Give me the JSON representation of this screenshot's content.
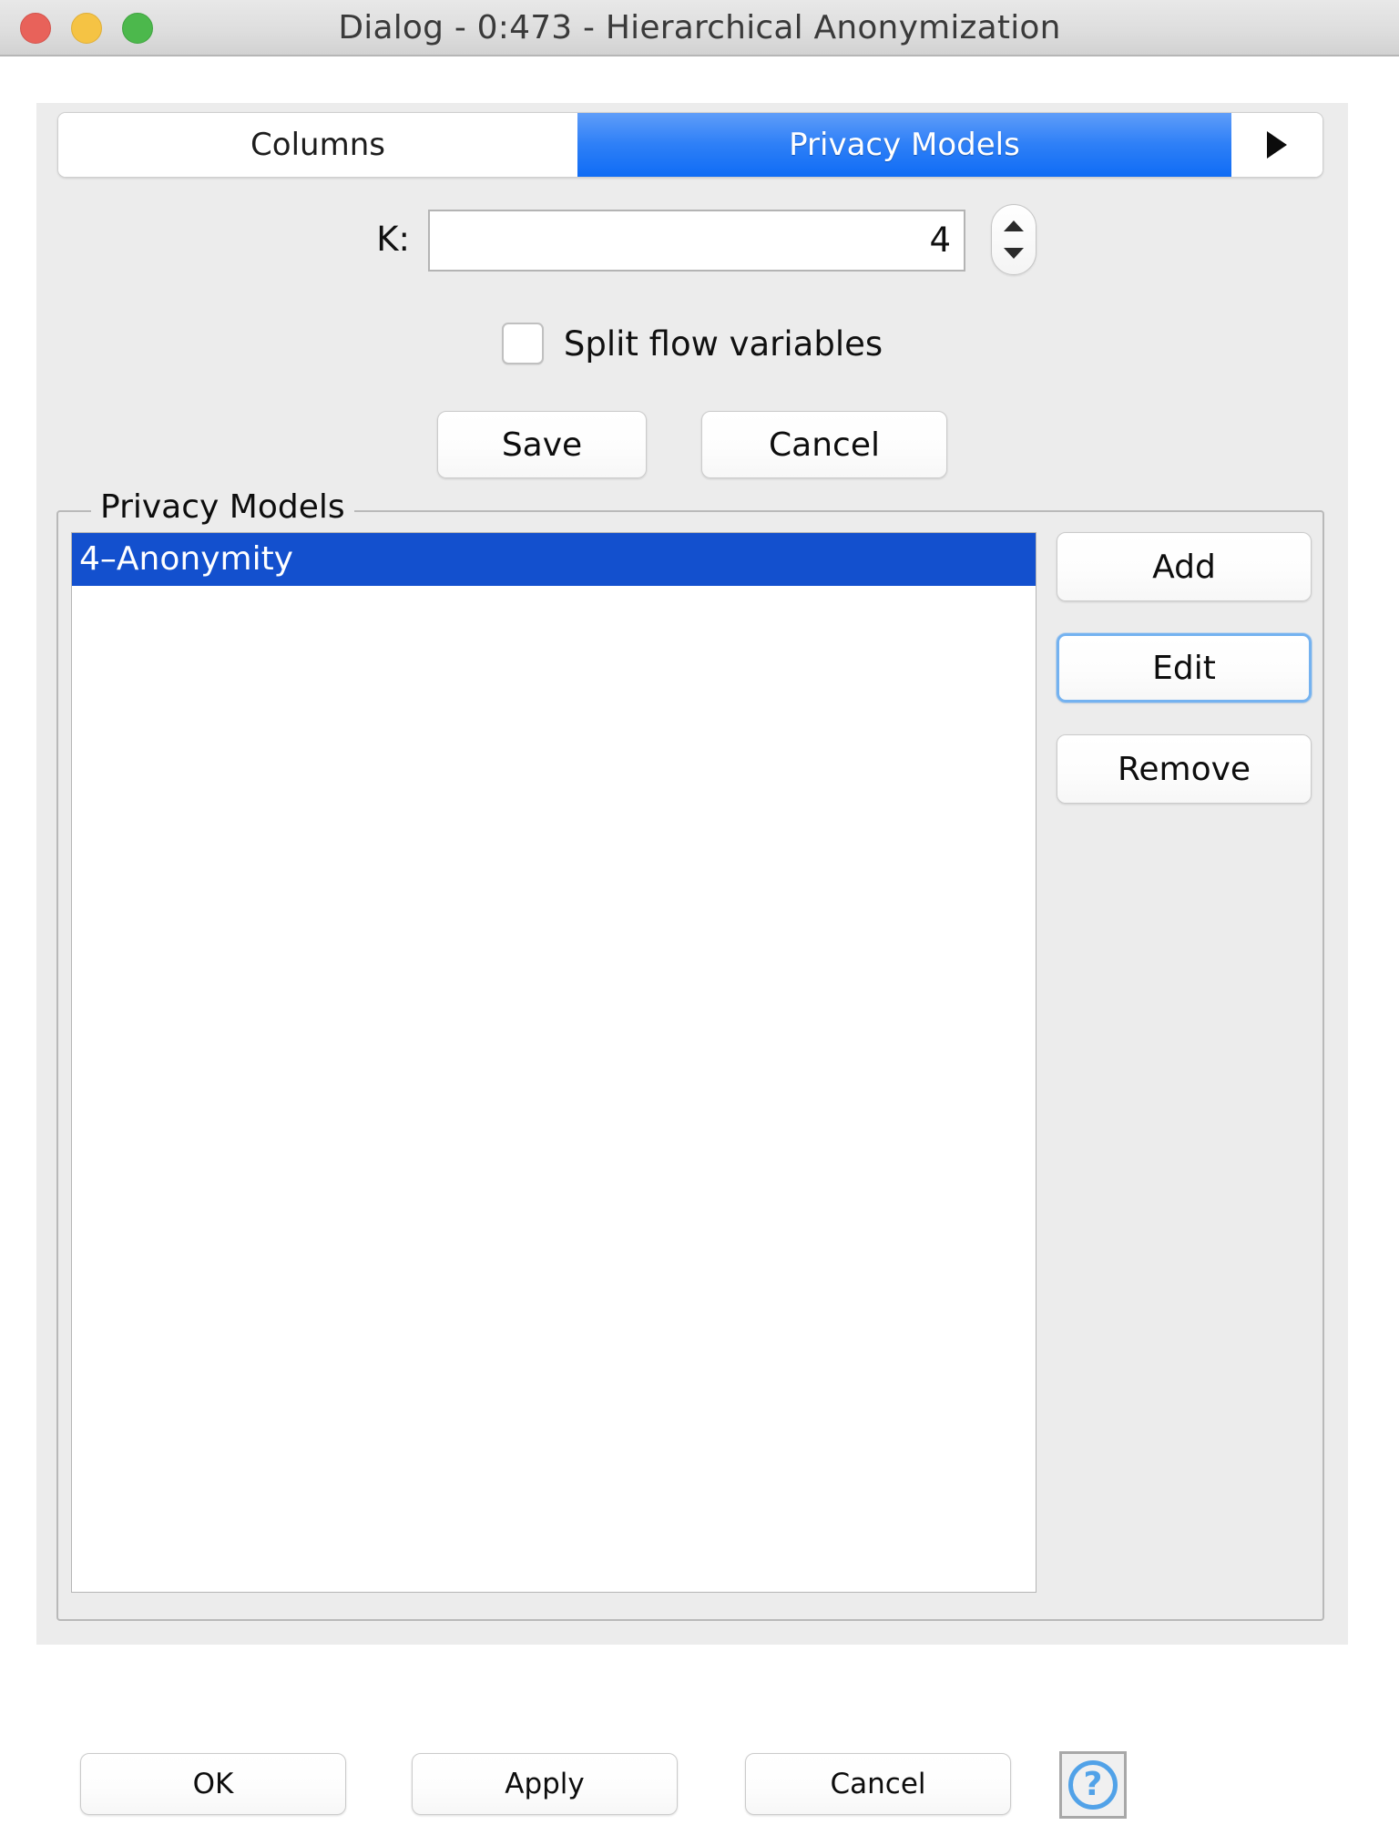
{
  "window": {
    "title": "Dialog - 0:473 - Hierarchical Anonymization",
    "traffic_lights": {
      "close": "close-button",
      "minimize": "minimize-button",
      "maximize": "maximize-button"
    },
    "colors": {
      "close": "#e8625a",
      "minimize": "#f5c344",
      "maximize": "#4cb84c",
      "accent_blue": "#0f6cf5",
      "selection_blue": "#1350ce",
      "focus_ring": "#74b2f0",
      "panel_bg": "#ececec",
      "help_blue": "#51a2e8"
    }
  },
  "tabs": {
    "items": [
      {
        "label": "Columns",
        "active": false
      },
      {
        "label": "Privacy Models",
        "active": true
      }
    ],
    "overflow_icon": "right-arrow-icon"
  },
  "settings": {
    "k": {
      "label": "K:",
      "value": "4",
      "stepper_up_icon": "chevron-up-icon",
      "stepper_down_icon": "chevron-down-icon"
    },
    "split_flow_variables": {
      "label": "Split flow variables",
      "checked": false
    },
    "save_label": "Save",
    "cancel_label": "Cancel"
  },
  "privacy_models": {
    "group_title": "Privacy Models",
    "items": [
      {
        "label": "4–Anonymity",
        "selected": true
      }
    ],
    "actions": {
      "add": "Add",
      "edit": "Edit",
      "remove": "Remove"
    }
  },
  "dialog_buttons": {
    "ok": "OK",
    "apply": "Apply",
    "cancel": "Cancel",
    "help_icon": "help-question-icon",
    "help_glyph": "?"
  }
}
